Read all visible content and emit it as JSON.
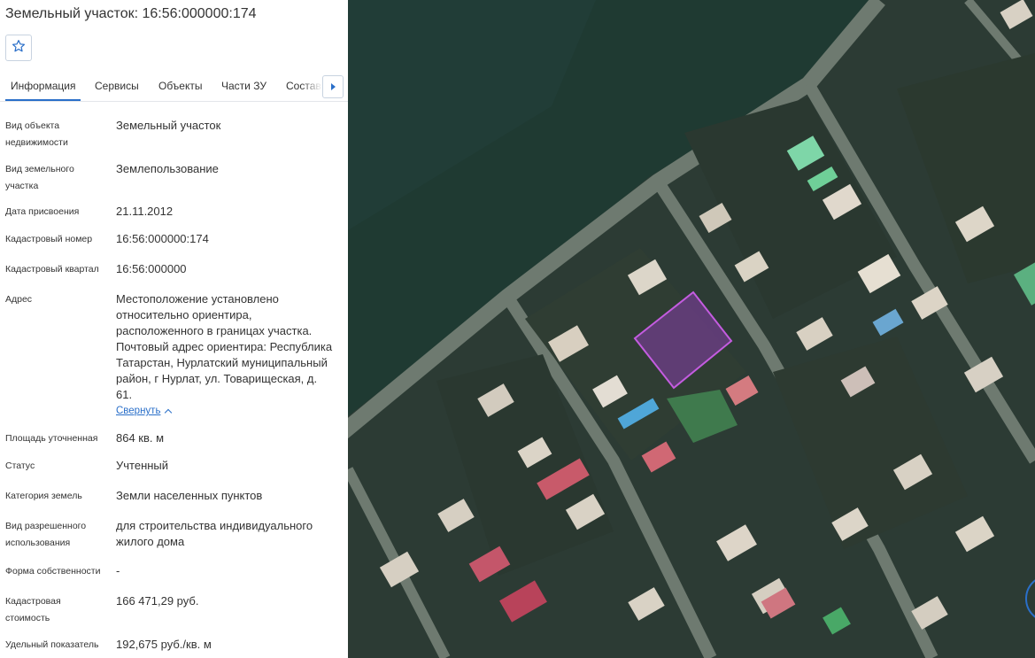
{
  "header": {
    "title": "Земельный участок: 16:56:000000:174",
    "favorite_icon": "star-icon"
  },
  "tabs": [
    {
      "label": "Информация",
      "active": true
    },
    {
      "label": "Сервисы",
      "active": false
    },
    {
      "label": "Объекты",
      "active": false
    },
    {
      "label": "Части ЗУ",
      "active": false
    },
    {
      "label": "Состав",
      "active": false
    }
  ],
  "tabs_next_icon": "caret-right-icon",
  "info": [
    {
      "label": "Вид объекта недвижимости",
      "value": "Земельный участок"
    },
    {
      "label": "Вид земельного участка",
      "value": "Землепользование"
    },
    {
      "label": "Дата присвоения",
      "value": "21.11.2012"
    },
    {
      "label": "Кадастровый номер",
      "value": "16:56:000000:174"
    },
    {
      "label": "Кадастровый квартал",
      "value": "16:56:000000"
    },
    {
      "label": "Адрес",
      "value": "Местоположение установлено относительно ориентира, расположенного в границах участка. Почтовый адрес ориентира: Республика Татарстан, Нурлатский муниципальный район, г Нурлат, ул. Товарищеская, д. 61."
    },
    {
      "label": "Площадь уточненная",
      "value": "864 кв. м"
    },
    {
      "label": "Статус",
      "value": "Учтенный"
    },
    {
      "label": "Категория земель",
      "value": "Земли населенных пунктов"
    },
    {
      "label": "Вид разрешенного использования",
      "value": "для строительства индивидуального жилого дома"
    },
    {
      "label": "Форма собственности",
      "value": "-"
    },
    {
      "label": "Кадастровая стоимость",
      "value": "166 471,29 руб."
    },
    {
      "label": "Удельный показатель",
      "value": "192,675 руб./кв. м"
    }
  ],
  "address_collapse_label": "Свернуть",
  "map": {
    "parcel_color": "#9b3fc4",
    "road_color": "#7a8275",
    "field_color": "#1f3a32"
  }
}
